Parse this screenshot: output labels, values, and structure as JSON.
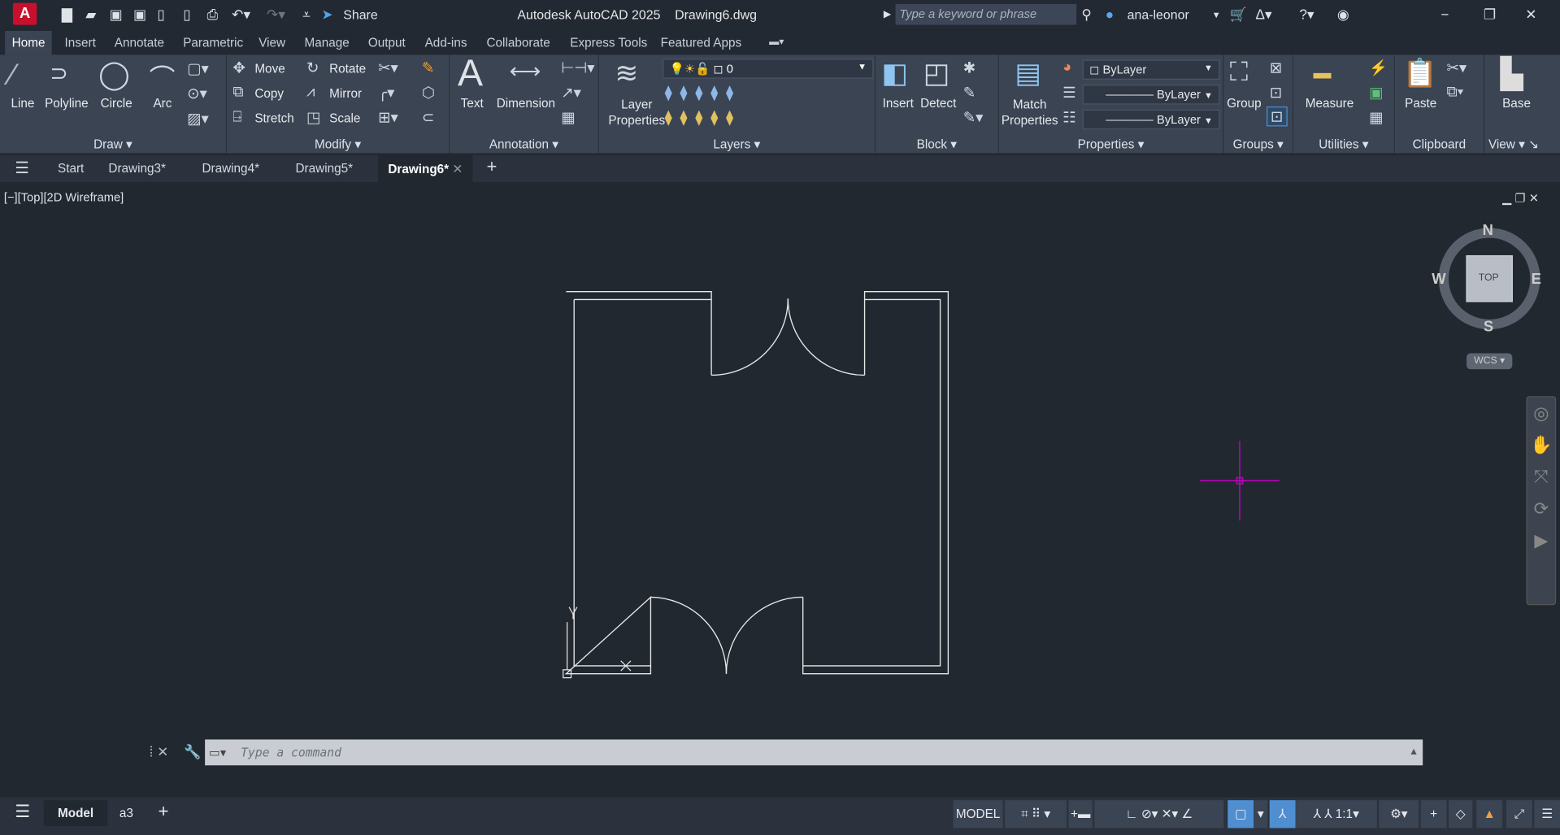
{
  "titlebar": {
    "app_title": "Autodesk AutoCAD 2025",
    "file_name": "Drawing6.dwg",
    "share": "Share",
    "search_placeholder": "Type a keyword or phrase",
    "user": "ana-leonor",
    "logo": "A"
  },
  "ribbon_tabs": [
    "Home",
    "Insert",
    "Annotate",
    "Parametric",
    "View",
    "Manage",
    "Output",
    "Add-ins",
    "Collaborate",
    "Express Tools",
    "Featured Apps"
  ],
  "draw": {
    "title": "Draw",
    "line": "Line",
    "polyline": "Polyline",
    "circle": "Circle",
    "arc": "Arc"
  },
  "modify": {
    "title": "Modify",
    "move": "Move",
    "rotate": "Rotate",
    "copy": "Copy",
    "mirror": "Mirror",
    "stretch": "Stretch",
    "scale": "Scale"
  },
  "annotation": {
    "title": "Annotation",
    "text": "Text",
    "dimension": "Dimension"
  },
  "layers": {
    "title": "Layers",
    "layer_properties_1": "Layer",
    "layer_properties_2": "Properties",
    "current_layer": "0"
  },
  "block": {
    "title": "Block",
    "insert": "Insert",
    "detect": "Detect"
  },
  "properties": {
    "title": "Properties",
    "match_1": "Match",
    "match_2": "Properties",
    "color": "ByLayer",
    "linetype": "ByLayer",
    "lineweight": "ByLayer"
  },
  "groups": {
    "title": "Groups",
    "group": "Group"
  },
  "utilities": {
    "title": "Utilities",
    "measure": "Measure"
  },
  "clipboard": {
    "title": "Clipboard",
    "paste": "Paste"
  },
  "view": {
    "title": "View",
    "base": "Base"
  },
  "file_tabs": {
    "start": "Start",
    "tabs": [
      "Drawing3*",
      "Drawing4*",
      "Drawing5*"
    ],
    "active": "Drawing6*"
  },
  "viewport": {
    "label": "[−][Top][2D Wireframe]",
    "compass": {
      "n": "N",
      "s": "S",
      "e": "E",
      "w": "W",
      "top": "TOP"
    },
    "wcs": "WCS"
  },
  "command": {
    "placeholder": "Type a command"
  },
  "layout_tabs": {
    "model": "Model",
    "layout": "a3"
  },
  "status": {
    "model": "MODEL",
    "scale": "1:1"
  },
  "colors": {
    "crosshair": "#c000c0",
    "accent": "#4f8fd1"
  }
}
